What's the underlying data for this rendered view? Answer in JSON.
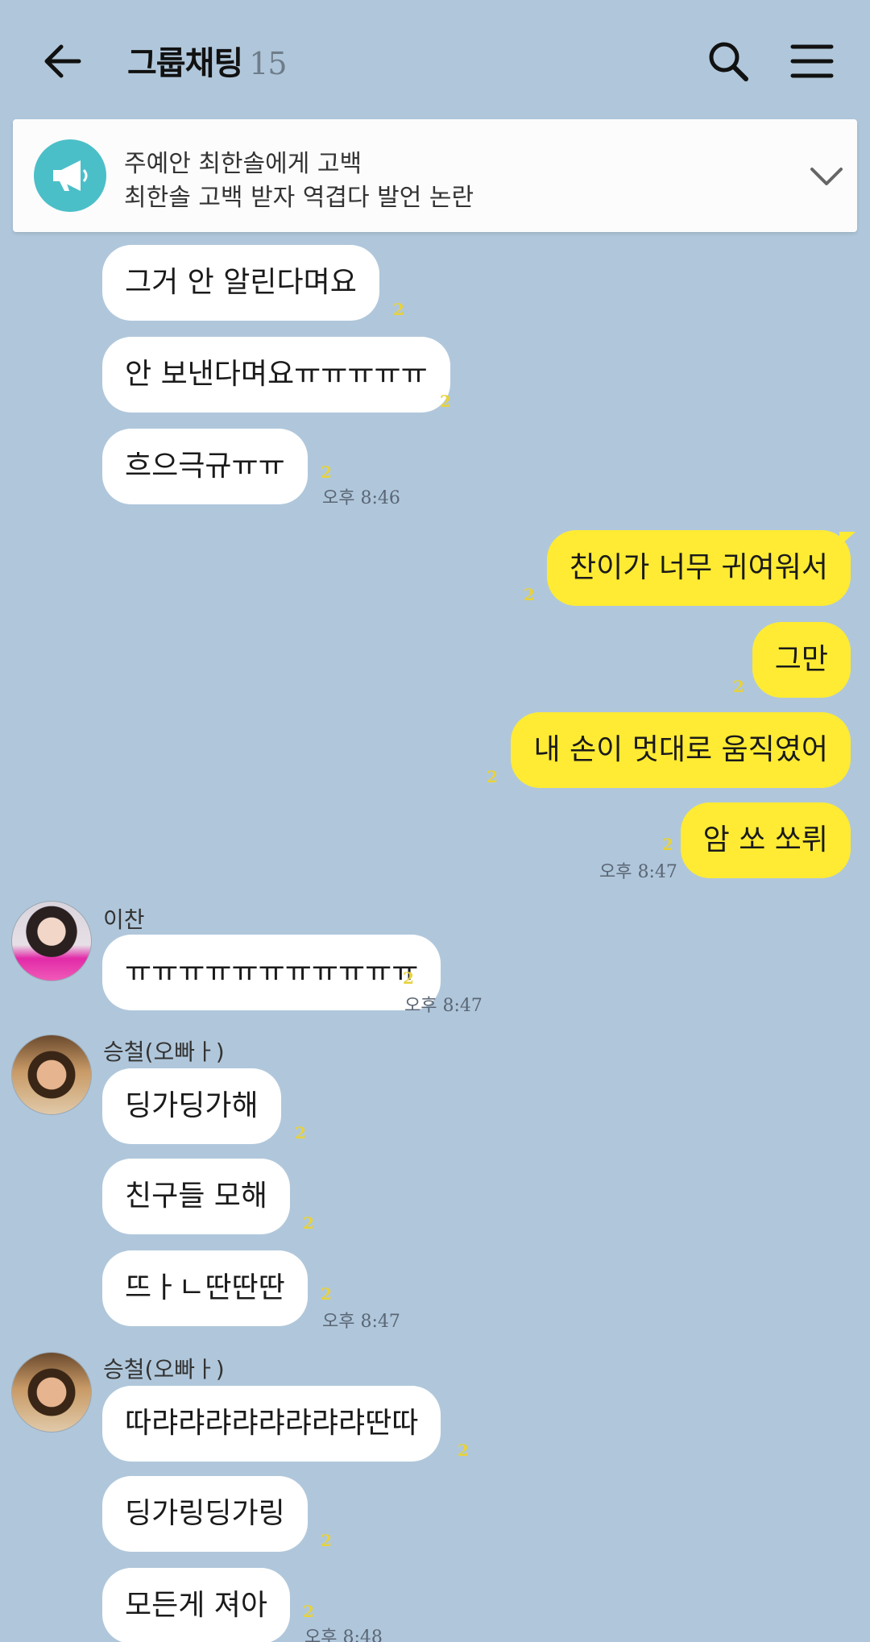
{
  "header": {
    "title": "그룹채팅",
    "member_count": "15"
  },
  "notice": {
    "line1": "주예안 최한솔에게 고백",
    "line2": "최한솔 고백 받자 역겹다 발언 논란"
  },
  "messages": [
    {
      "text": "그거 안 알린다며요",
      "unread": "2"
    },
    {
      "text": "안 보낸다며요ㅠㅠㅠㅠㅠ",
      "unread": "2"
    },
    {
      "text": "흐으극규ㅠㅠ",
      "unread": "2",
      "time": "오후 8:46"
    },
    {
      "text": "찬이가 너무 귀여워서",
      "unread": "2"
    },
    {
      "text": "그만",
      "unread": "2"
    },
    {
      "text": "내 손이 멋대로 움직였어",
      "unread": "2"
    },
    {
      "text": "암 쏘 쏘뤼",
      "unread": "2",
      "time": "오후 8:47"
    },
    {
      "sender": "이찬",
      "text": "ㅠㅠㅠㅠㅠㅠㅠㅠㅠㅠㅠ",
      "unread": "2",
      "time": "오후 8:47"
    },
    {
      "sender": "승철(오빠ㅏ)",
      "text": "딩가딩가해",
      "unread": "2"
    },
    {
      "text": "친구들 모해",
      "unread": "2"
    },
    {
      "text": "뜨ㅏㄴ딴딴딴",
      "unread": "2",
      "time": "오후 8:47"
    },
    {
      "sender": "승철(오빠ㅏ)",
      "text": "따랴랴랴랴랴랴랴랴딴따",
      "unread": "2"
    },
    {
      "text": "딩가링딩가링",
      "unread": "2"
    },
    {
      "text": "모든게 져아",
      "unread": "2",
      "time": "오후 8:48"
    }
  ],
  "colors": {
    "background": "#b0c7db",
    "my_bubble": "#ffeb33",
    "other_bubble": "#ffffff",
    "notice_icon": "#4bbfc8",
    "unread": "#e8d23a"
  },
  "icons": [
    "back-arrow-icon",
    "search-icon",
    "menu-icon",
    "megaphone-icon",
    "chevron-down-icon"
  ]
}
